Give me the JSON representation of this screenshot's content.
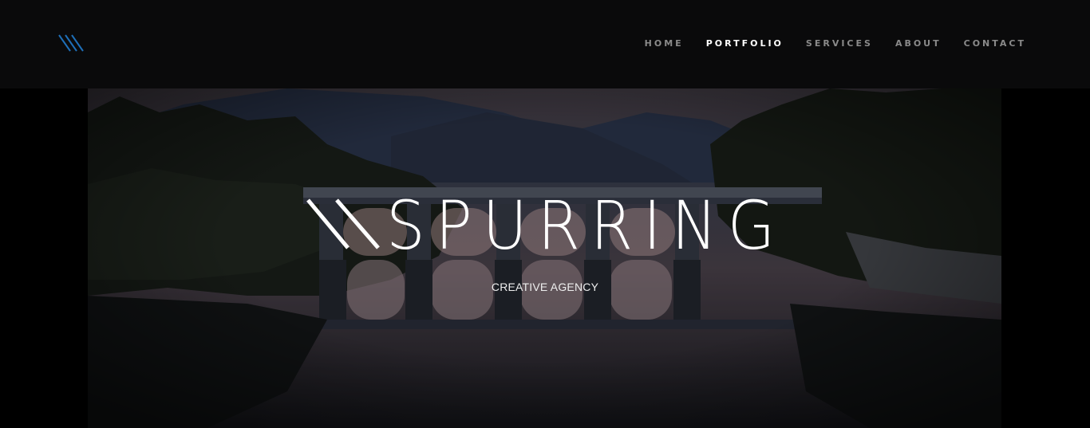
{
  "header": {
    "logo_icon": "triple-slash-logo-icon",
    "accent_color": "#1e6fb8",
    "nav": [
      {
        "label": "HOME",
        "active": false
      },
      {
        "label": "PORTFOLIO",
        "active": true
      },
      {
        "label": "SERVICES",
        "active": false
      },
      {
        "label": "ABOUT",
        "active": false
      },
      {
        "label": "CONTACT",
        "active": false
      }
    ]
  },
  "hero": {
    "brand": "SPURRING",
    "tagline": "CREATIVE AGENCY",
    "background": "bridge-over-lake-at-dusk-photo"
  }
}
